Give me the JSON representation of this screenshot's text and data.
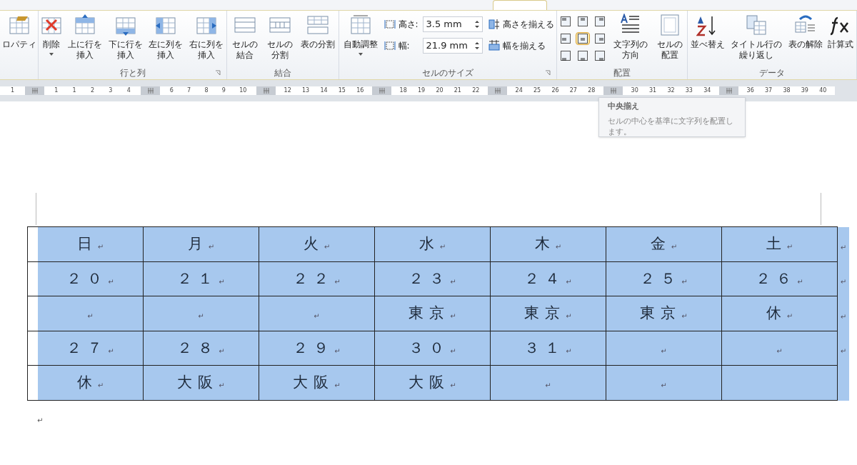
{
  "ribbon": {
    "groups": [
      {
        "items": [
          {
            "kind": "large",
            "label": "ロパティ"
          }
        ]
      },
      {
        "label": "行と列",
        "launcher": true,
        "items": [
          {
            "kind": "large",
            "label": "削除",
            "dropdown": true
          },
          {
            "kind": "large",
            "label": "上に行を挿入"
          },
          {
            "kind": "large",
            "label": "下に行を挿入"
          },
          {
            "kind": "large",
            "label": "左に列を挿入"
          },
          {
            "kind": "large",
            "label": "右に列を挿入"
          }
        ]
      },
      {
        "label": "結合",
        "items": [
          {
            "kind": "large",
            "label": "セルの結合"
          },
          {
            "kind": "large",
            "label": "セルの分割"
          },
          {
            "kind": "large",
            "label": "表の分割"
          }
        ]
      },
      {
        "label": "セルのサイズ",
        "launcher": true,
        "items": [
          {
            "kind": "large",
            "label": "自動調整",
            "dropdown": true
          },
          {
            "kind": "size",
            "height_label": "高さ:",
            "height_value": "3.5 mm",
            "width_label": "幅:",
            "width_value": "21.9 mm",
            "distribute_rows": "高さを揃える",
            "distribute_cols": "幅を揃える"
          }
        ]
      },
      {
        "label": "配置",
        "items": [
          {
            "kind": "align",
            "cells": [
              {
                "selected": false
              },
              {
                "selected": false
              },
              {
                "selected": false
              },
              {
                "selected": false
              },
              {
                "selected": true
              },
              {
                "selected": false
              },
              {
                "selected": false
              },
              {
                "selected": false
              },
              {
                "selected": false
              }
            ]
          },
          {
            "kind": "large",
            "label": "文字列の方向"
          },
          {
            "kind": "large",
            "label": "セルの配置"
          }
        ]
      },
      {
        "label": "データ",
        "items": [
          {
            "kind": "large",
            "label": "並べ替え"
          },
          {
            "kind": "large",
            "label": "タイトル行の繰り返し"
          },
          {
            "kind": "large",
            "label": "表の解除"
          },
          {
            "kind": "large",
            "label": "計算式"
          }
        ]
      }
    ]
  },
  "ruler": {
    "segments": [
      [
        "1"
      ],
      [
        "1",
        "1",
        "2",
        "3",
        "4"
      ],
      [
        "6",
        "7",
        "8",
        "9",
        "10"
      ],
      [
        "12",
        "13",
        "14",
        "15",
        "16"
      ],
      [
        "18",
        "19",
        "20",
        "21",
        "22"
      ],
      [
        "24",
        "25",
        "26",
        "27",
        "28"
      ],
      [
        "30",
        "31",
        "32",
        "33",
        "34"
      ],
      [
        "36",
        "37",
        "38",
        "39",
        "40"
      ]
    ]
  },
  "tooltip": {
    "title": "中央揃え",
    "body": "セルの中心を基準に文字列を配置します。"
  },
  "table": {
    "rows": [
      {
        "end_mark": "↵",
        "cells": [
          {
            "text": "日",
            "mark": "↵"
          },
          {
            "text": "月",
            "mark": "↵"
          },
          {
            "text": "火",
            "mark": "↵"
          },
          {
            "text": "水",
            "mark": "↵"
          },
          {
            "text": "木",
            "mark": "↵"
          },
          {
            "text": "金",
            "mark": "↵"
          },
          {
            "text": "土",
            "mark": "↵"
          }
        ]
      },
      {
        "end_mark": "↵",
        "cells": [
          {
            "text": "２０",
            "mark": "↵"
          },
          {
            "text": "２１",
            "mark": "↵"
          },
          {
            "text": "２２",
            "mark": "↵"
          },
          {
            "text": "２３",
            "mark": "↵"
          },
          {
            "text": "２４",
            "mark": "↵"
          },
          {
            "text": "２５",
            "mark": "↵"
          },
          {
            "text": "２６",
            "mark": "↵"
          }
        ]
      },
      {
        "end_mark": "↵",
        "cells": [
          {
            "mark": "↵"
          },
          {
            "mark": "↵"
          },
          {
            "mark": "↵"
          },
          {
            "text": "東京",
            "mark": "↵"
          },
          {
            "text": "東京",
            "mark": "↵"
          },
          {
            "text": "東京",
            "mark": "↵"
          },
          {
            "text": "休",
            "mark": "↵"
          }
        ]
      },
      {
        "end_mark": "↵",
        "cells": [
          {
            "text": "２７",
            "mark": "↵"
          },
          {
            "text": "２８",
            "mark": "↵"
          },
          {
            "text": "２９",
            "mark": "↵"
          },
          {
            "text": "３０",
            "mark": "↵"
          },
          {
            "text": "３１",
            "mark": "↵"
          },
          {
            "mark": "↵"
          },
          {
            "mark": "↵"
          }
        ]
      },
      {
        "cells": [
          {
            "text": "休",
            "mark": "↵"
          },
          {
            "text": "大阪",
            "mark": "↵"
          },
          {
            "text": "大阪",
            "mark": "↵"
          },
          {
            "text": "大阪",
            "mark": "↵"
          },
          {
            "mark": "↵"
          },
          {
            "mark": "↵"
          },
          {}
        ]
      }
    ],
    "selected": true
  },
  "after_table_mark": "↵"
}
